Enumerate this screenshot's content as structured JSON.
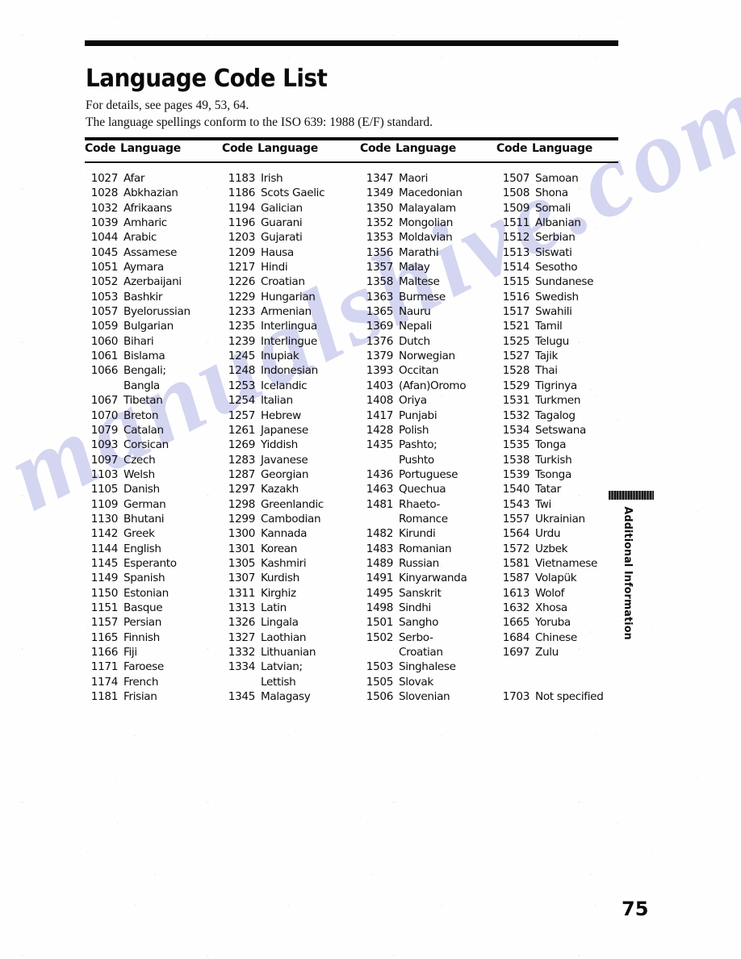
{
  "page": {
    "title": "Language Code List",
    "intro_line_1": "For details, see pages 49, 53, 64.",
    "intro_line_2": "The language spellings conform to the ISO 639: 1988 (E/F) standard.",
    "folio": "75",
    "side_tab_label": "Additional Information",
    "watermark_text": "manualshive.com",
    "ink_color": "#0a0a0a",
    "paper_color": "#ffffff",
    "watermark_color": "#9698dc"
  },
  "table": {
    "header": {
      "code": "Code",
      "language": "Language"
    },
    "columns": [
      {
        "rows": [
          {
            "code": "1027",
            "language": "Afar"
          },
          {
            "code": "1028",
            "language": "Abkhazian"
          },
          {
            "code": "1032",
            "language": "Afrikaans"
          },
          {
            "code": "1039",
            "language": "Amharic"
          },
          {
            "code": "1044",
            "language": "Arabic"
          },
          {
            "code": "1045",
            "language": "Assamese"
          },
          {
            "code": "1051",
            "language": "Aymara"
          },
          {
            "code": "1052",
            "language": "Azerbaijani"
          },
          {
            "code": "1053",
            "language": "Bashkir"
          },
          {
            "code": "1057",
            "language": "Byelorussian"
          },
          {
            "code": "1059",
            "language": "Bulgarian"
          },
          {
            "code": "1060",
            "language": "Bihari"
          },
          {
            "code": "1061",
            "language": "Bislama"
          },
          {
            "code": "1066",
            "language": "Bengali;"
          },
          {
            "code": "",
            "language": "Bangla"
          },
          {
            "code": "1067",
            "language": "Tibetan"
          },
          {
            "code": "1070",
            "language": "Breton"
          },
          {
            "code": "1079",
            "language": "Catalan"
          },
          {
            "code": "1093",
            "language": "Corsican"
          },
          {
            "code": "1097",
            "language": "Czech"
          },
          {
            "code": "1103",
            "language": "Welsh"
          },
          {
            "code": "1105",
            "language": "Danish"
          },
          {
            "code": "1109",
            "language": "German"
          },
          {
            "code": "1130",
            "language": "Bhutani"
          },
          {
            "code": "1142",
            "language": "Greek"
          },
          {
            "code": "1144",
            "language": "English"
          },
          {
            "code": "1145",
            "language": "Esperanto"
          },
          {
            "code": "1149",
            "language": "Spanish"
          },
          {
            "code": "1150",
            "language": "Estonian"
          },
          {
            "code": "1151",
            "language": "Basque"
          },
          {
            "code": "1157",
            "language": "Persian"
          },
          {
            "code": "1165",
            "language": "Finnish"
          },
          {
            "code": "1166",
            "language": "Fiji"
          },
          {
            "code": "1171",
            "language": "Faroese"
          },
          {
            "code": "1174",
            "language": "French"
          },
          {
            "code": "1181",
            "language": "Frisian"
          }
        ]
      },
      {
        "rows": [
          {
            "code": "1183",
            "language": "Irish"
          },
          {
            "code": "1186",
            "language": "Scots Gaelic"
          },
          {
            "code": "1194",
            "language": "Galician"
          },
          {
            "code": "1196",
            "language": "Guarani"
          },
          {
            "code": "1203",
            "language": "Gujarati"
          },
          {
            "code": "1209",
            "language": "Hausa"
          },
          {
            "code": "1217",
            "language": "Hindi"
          },
          {
            "code": "1226",
            "language": "Croatian"
          },
          {
            "code": "1229",
            "language": "Hungarian"
          },
          {
            "code": "1233",
            "language": "Armenian"
          },
          {
            "code": "1235",
            "language": "Interlingua"
          },
          {
            "code": "1239",
            "language": "Interlingue"
          },
          {
            "code": "1245",
            "language": "Inupiak"
          },
          {
            "code": "1248",
            "language": "Indonesian"
          },
          {
            "code": "1253",
            "language": "Icelandic"
          },
          {
            "code": "1254",
            "language": "Italian"
          },
          {
            "code": "1257",
            "language": "Hebrew"
          },
          {
            "code": "1261",
            "language": "Japanese"
          },
          {
            "code": "1269",
            "language": "Yiddish"
          },
          {
            "code": "1283",
            "language": "Javanese"
          },
          {
            "code": "1287",
            "language": "Georgian"
          },
          {
            "code": "1297",
            "language": "Kazakh"
          },
          {
            "code": "1298",
            "language": "Greenlandic"
          },
          {
            "code": "1299",
            "language": "Cambodian"
          },
          {
            "code": "1300",
            "language": "Kannada"
          },
          {
            "code": "1301",
            "language": "Korean"
          },
          {
            "code": "1305",
            "language": "Kashmiri"
          },
          {
            "code": "1307",
            "language": "Kurdish"
          },
          {
            "code": "1311",
            "language": "Kirghiz"
          },
          {
            "code": "1313",
            "language": "Latin"
          },
          {
            "code": "1326",
            "language": "Lingala"
          },
          {
            "code": "1327",
            "language": "Laothian"
          },
          {
            "code": "1332",
            "language": "Lithuanian"
          },
          {
            "code": "1334",
            "language": "Latvian;"
          },
          {
            "code": "",
            "language": "Lettish"
          },
          {
            "code": "1345",
            "language": "Malagasy"
          }
        ]
      },
      {
        "rows": [
          {
            "code": "1347",
            "language": "Maori"
          },
          {
            "code": "1349",
            "language": "Macedonian"
          },
          {
            "code": "1350",
            "language": "Malayalam"
          },
          {
            "code": "1352",
            "language": "Mongolian"
          },
          {
            "code": "1353",
            "language": "Moldavian"
          },
          {
            "code": "1356",
            "language": "Marathi"
          },
          {
            "code": "1357",
            "language": "Malay"
          },
          {
            "code": "1358",
            "language": "Maltese"
          },
          {
            "code": "1363",
            "language": "Burmese"
          },
          {
            "code": "1365",
            "language": "Nauru"
          },
          {
            "code": "1369",
            "language": "Nepali"
          },
          {
            "code": "1376",
            "language": "Dutch"
          },
          {
            "code": "1379",
            "language": "Norwegian"
          },
          {
            "code": "1393",
            "language": "Occitan"
          },
          {
            "code": "1403",
            "language": "(Afan)Oromo"
          },
          {
            "code": "1408",
            "language": "Oriya"
          },
          {
            "code": "1417",
            "language": "Punjabi"
          },
          {
            "code": "1428",
            "language": "Polish"
          },
          {
            "code": "1435",
            "language": "Pashto;"
          },
          {
            "code": "",
            "language": "Pushto"
          },
          {
            "code": "1436",
            "language": "Portuguese"
          },
          {
            "code": "1463",
            "language": "Quechua"
          },
          {
            "code": "1481",
            "language": "Rhaeto-"
          },
          {
            "code": "",
            "language": "Romance"
          },
          {
            "code": "1482",
            "language": "Kirundi"
          },
          {
            "code": "1483",
            "language": "Romanian"
          },
          {
            "code": "1489",
            "language": "Russian"
          },
          {
            "code": "1491",
            "language": "Kinyarwanda"
          },
          {
            "code": "1495",
            "language": "Sanskrit"
          },
          {
            "code": "1498",
            "language": "Sindhi"
          },
          {
            "code": "1501",
            "language": "Sangho"
          },
          {
            "code": "1502",
            "language": "Serbo-"
          },
          {
            "code": "",
            "language": "Croatian"
          },
          {
            "code": "1503",
            "language": "Singhalese"
          },
          {
            "code": "1505",
            "language": "Slovak"
          },
          {
            "code": "1506",
            "language": "Slovenian"
          }
        ]
      },
      {
        "rows": [
          {
            "code": "1507",
            "language": "Samoan"
          },
          {
            "code": "1508",
            "language": "Shona"
          },
          {
            "code": "1509",
            "language": "Somali"
          },
          {
            "code": "1511",
            "language": "Albanian"
          },
          {
            "code": "1512",
            "language": "Serbian"
          },
          {
            "code": "1513",
            "language": "Siswati"
          },
          {
            "code": "1514",
            "language": "Sesotho"
          },
          {
            "code": "1515",
            "language": "Sundanese"
          },
          {
            "code": "1516",
            "language": "Swedish"
          },
          {
            "code": "1517",
            "language": "Swahili"
          },
          {
            "code": "1521",
            "language": "Tamil"
          },
          {
            "code": "1525",
            "language": "Telugu"
          },
          {
            "code": "1527",
            "language": "Tajik"
          },
          {
            "code": "1528",
            "language": "Thai"
          },
          {
            "code": "1529",
            "language": "Tigrinya"
          },
          {
            "code": "1531",
            "language": "Turkmen"
          },
          {
            "code": "1532",
            "language": "Tagalog"
          },
          {
            "code": "1534",
            "language": "Setswana"
          },
          {
            "code": "1535",
            "language": "Tonga"
          },
          {
            "code": "1538",
            "language": "Turkish"
          },
          {
            "code": "1539",
            "language": "Tsonga"
          },
          {
            "code": "1540",
            "language": "Tatar"
          },
          {
            "code": "1543",
            "language": "Twi"
          },
          {
            "code": "1557",
            "language": "Ukrainian"
          },
          {
            "code": "1564",
            "language": "Urdu"
          },
          {
            "code": "1572",
            "language": "Uzbek"
          },
          {
            "code": "1581",
            "language": "Vietnamese"
          },
          {
            "code": "1587",
            "language": "Volapük"
          },
          {
            "code": "1613",
            "language": "Wolof"
          },
          {
            "code": "1632",
            "language": "Xhosa"
          },
          {
            "code": "1665",
            "language": "Yoruba"
          },
          {
            "code": "1684",
            "language": "Chinese"
          },
          {
            "code": "1697",
            "language": "Zulu"
          },
          {
            "code": "",
            "language": ""
          },
          {
            "code": "",
            "language": ""
          },
          {
            "code": "1703",
            "language": "Not specified"
          }
        ]
      }
    ]
  }
}
